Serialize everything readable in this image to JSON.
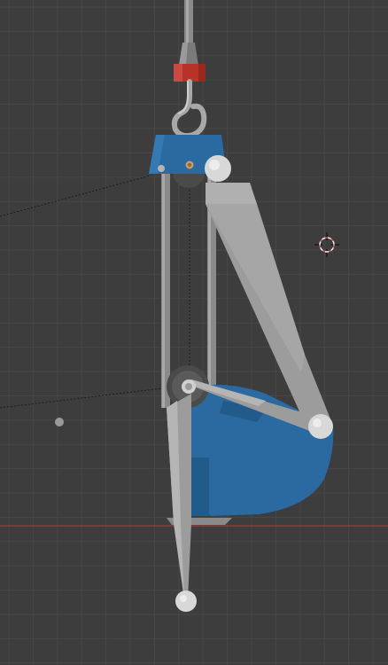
{
  "viewport": {
    "background_color": "#3d3d3d",
    "grid_minor_color": "#474747",
    "grid_major_color": "#525252",
    "x_axis_color": "#8a3c3c"
  },
  "scene": {
    "body_color": "#2a6aa0",
    "body_shadow_color": "#225a8a",
    "arm_color": "#9c9c9c",
    "arm_light_color": "#b5b5b5",
    "rod_color": "#8a8a8a",
    "joint_color": "#d8d8d8",
    "collar_color": "#b8322a",
    "relationship_line_color": "#1a1a1a"
  },
  "icons": {
    "cursor": "3d-cursor-icon",
    "origin": "object-origin-icon"
  }
}
